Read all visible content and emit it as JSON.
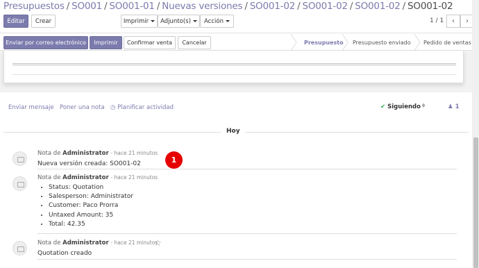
{
  "breadcrumb": [
    "Presupuestos",
    "SO001",
    "SO001-01",
    "Nuevas versiones",
    "SO001-02",
    "SO001-02",
    "SO001-02",
    "SO001-02"
  ],
  "toolbar": {
    "edit": "Editar",
    "create": "Crear",
    "print": "Imprimir",
    "attachments": "Adjunto(s)",
    "action": "Acción",
    "pager": "1 / 1",
    "prev_icon": "chevron-left-icon",
    "next_icon": "chevron-right-icon"
  },
  "actions": {
    "send_email": "Enviar por correo electrónico",
    "print": "Imprimir",
    "confirm": "Confirmar venta",
    "cancel": "Cancelar"
  },
  "statusbar": [
    "Presupuesto",
    "Presupuesto enviado",
    "Pedido de ventas"
  ],
  "chatter": {
    "send_message": "Enviar mensaje",
    "log_note": "Poner una nota",
    "schedule": "Planificar actividad",
    "following": "Siguiendo",
    "followers_count": "1"
  },
  "date_separator": "Hoy",
  "messages": [
    {
      "prefix": "Nota de",
      "author": "Administrator",
      "time": "- hace 21 minutos",
      "body": "Nueva versión creada: SO001-02"
    },
    {
      "prefix": "Nota de",
      "author": "Administrator",
      "time": "- hace 21 minutos",
      "items": [
        "Status: Quotation",
        "Salesperson: Administrator",
        "Customer: Paco Prorra",
        "Untaxed Amount: 35",
        "Total: 42.35"
      ]
    },
    {
      "prefix": "Nota de",
      "author": "Administrator",
      "time": "- hace 21 minutos",
      "body": "Quotation creado"
    }
  ],
  "annotation_badge": "1",
  "colors": {
    "accent": "#7c7bad",
    "badge": "#e60000",
    "check": "#28a745"
  }
}
